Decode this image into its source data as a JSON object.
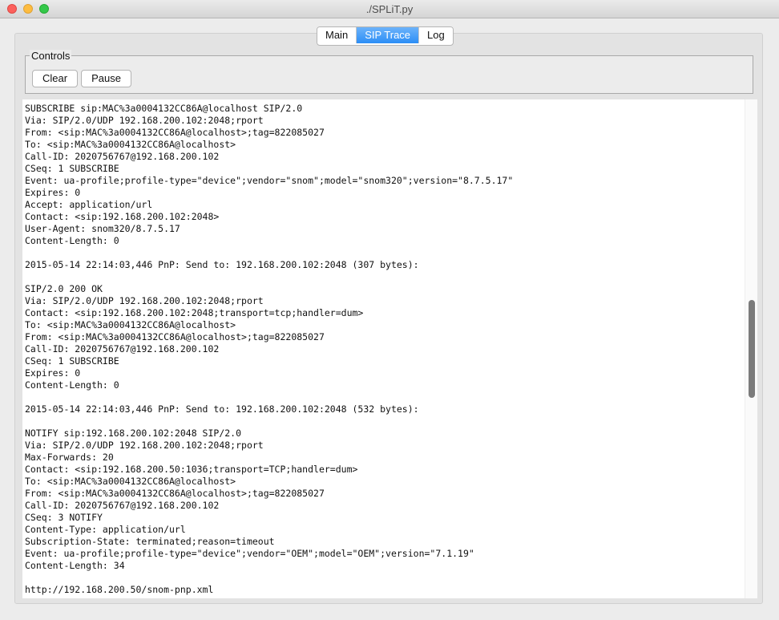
{
  "window": {
    "title": "./SPLiT.py"
  },
  "tabs": [
    {
      "label": "Main"
    },
    {
      "label": "SIP Trace"
    },
    {
      "label": "Log"
    }
  ],
  "controls": {
    "legend": "Controls",
    "clear_label": "Clear",
    "pause_label": "Pause"
  },
  "log": {
    "lines": [
      "SUBSCRIBE sip:MAC%3a0004132CC86A@localhost SIP/2.0",
      "Via: SIP/2.0/UDP 192.168.200.102:2048;rport",
      "From: <sip:MAC%3a0004132CC86A@localhost>;tag=822085027",
      "To: <sip:MAC%3a0004132CC86A@localhost>",
      "Call-ID: 2020756767@192.168.200.102",
      "CSeq: 1 SUBSCRIBE",
      "Event: ua-profile;profile-type=\"device\";vendor=\"snom\";model=\"snom320\";version=\"8.7.5.17\"",
      "Expires: 0",
      "Accept: application/url",
      "Contact: <sip:192.168.200.102:2048>",
      "User-Agent: snom320/8.7.5.17",
      "Content-Length: 0",
      "",
      "2015-05-14 22:14:03,446 PnP: Send to: 192.168.200.102:2048 (307 bytes):",
      "",
      "SIP/2.0 200 OK",
      "Via: SIP/2.0/UDP 192.168.200.102:2048;rport",
      "Contact: <sip:192.168.200.102:2048;transport=tcp;handler=dum>",
      "To: <sip:MAC%3a0004132CC86A@localhost>",
      "From: <sip:MAC%3a0004132CC86A@localhost>;tag=822085027",
      "Call-ID: 2020756767@192.168.200.102",
      "CSeq: 1 SUBSCRIBE",
      "Expires: 0",
      "Content-Length: 0",
      "",
      "2015-05-14 22:14:03,446 PnP: Send to: 192.168.200.102:2048 (532 bytes):",
      "",
      "NOTIFY sip:192.168.200.102:2048 SIP/2.0",
      "Via: SIP/2.0/UDP 192.168.200.102:2048;rport",
      "Max-Forwards: 20",
      "Contact: <sip:192.168.200.50:1036;transport=TCP;handler=dum>",
      "To: <sip:MAC%3a0004132CC86A@localhost>",
      "From: <sip:MAC%3a0004132CC86A@localhost>;tag=822085027",
      "Call-ID: 2020756767@192.168.200.102",
      "CSeq: 3 NOTIFY",
      "Content-Type: application/url",
      "Subscription-State: terminated;reason=timeout",
      "Event: ua-profile;profile-type=\"device\";vendor=\"OEM\";model=\"OEM\";version=\"7.1.19\"",
      "Content-Length: 34",
      "",
      "http://192.168.200.50/snom-pnp.xml"
    ]
  },
  "colors": {
    "active_tab": "#2c8ef6",
    "close": "#fc605c",
    "minimize": "#fdbc40",
    "maximize": "#34c84a"
  }
}
